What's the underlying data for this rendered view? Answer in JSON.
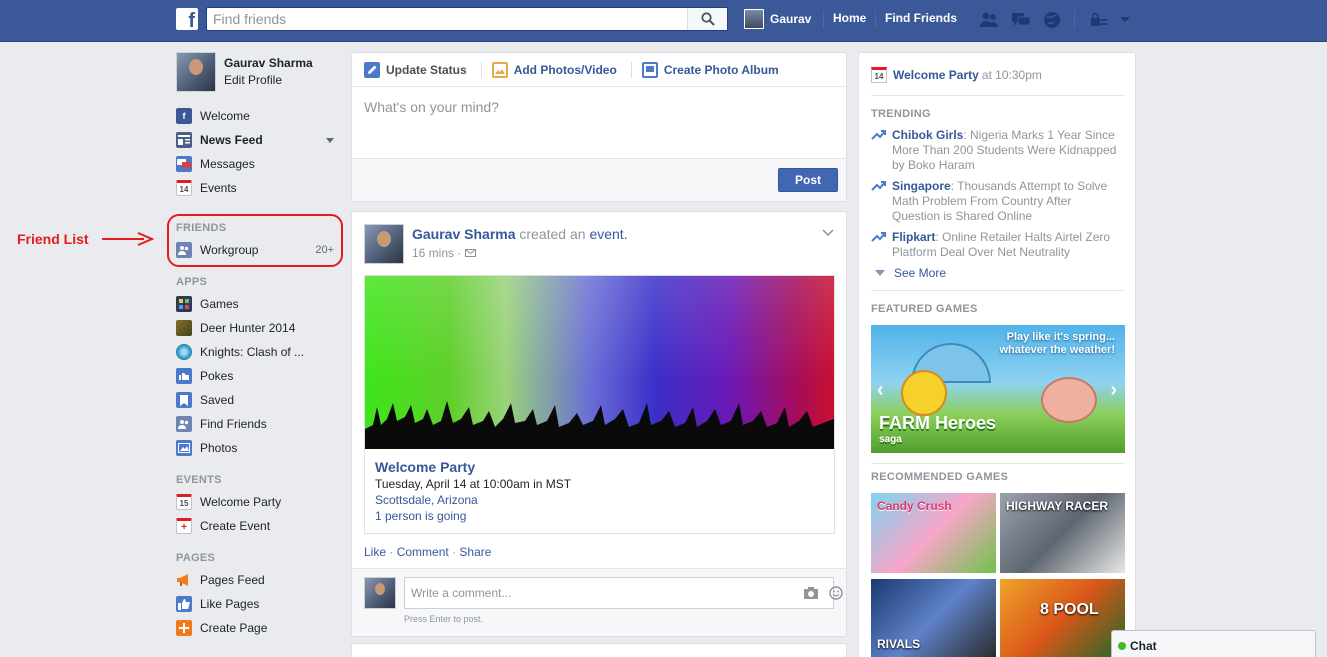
{
  "topbar": {
    "logo": "f",
    "search_placeholder": "Find friends",
    "user_name": "Gaurav",
    "home_label": "Home",
    "find_friends_label": "Find Friends"
  },
  "profile": {
    "name": "Gaurav Sharma",
    "edit_label": "Edit Profile"
  },
  "nav": {
    "main": [
      {
        "label": "Welcome",
        "icon": "facebook-icon"
      },
      {
        "label": "News Feed",
        "icon": "news-feed-icon"
      },
      {
        "label": "Messages",
        "icon": "messages-icon"
      },
      {
        "label": "Events",
        "icon": "calendar-icon",
        "badge": "14"
      }
    ],
    "friends_header": "FRIENDS",
    "friends": [
      {
        "label": "Workgroup",
        "count": "20+"
      }
    ],
    "apps_header": "APPS",
    "apps": [
      {
        "label": "Games"
      },
      {
        "label": "Deer Hunter 2014"
      },
      {
        "label": "Knights: Clash of ..."
      },
      {
        "label": "Pokes"
      },
      {
        "label": "Saved"
      },
      {
        "label": "Find Friends"
      },
      {
        "label": "Photos"
      }
    ],
    "events_header": "EVENTS",
    "events": [
      {
        "label": "Welcome Party",
        "badge": "15"
      },
      {
        "label": "Create Event",
        "badge": "+"
      }
    ],
    "pages_header": "PAGES",
    "pages": [
      {
        "label": "Pages Feed"
      },
      {
        "label": "Like Pages"
      },
      {
        "label": "Create Page"
      }
    ]
  },
  "annotation": {
    "label": "Friend List",
    "color": "#e31b23"
  },
  "composer": {
    "tabs": [
      "Update Status",
      "Add Photos/Video",
      "Create Photo Album"
    ],
    "placeholder": "What's on your mind?",
    "post_label": "Post"
  },
  "story": {
    "author": "Gaurav Sharma",
    "action": "created an",
    "object": "event.",
    "time": "16 mins ·",
    "event": {
      "name": "Welcome Party",
      "date": "Tuesday, April 14 at 10:00am in MST",
      "location": "Scottsdale, Arizona",
      "going": "1 person is going"
    },
    "actions": [
      "Like",
      "Comment",
      "Share"
    ],
    "comment_placeholder": "Write a comment...",
    "comment_hint": "Press Enter to post."
  },
  "rightcol": {
    "event_name": "Welcome Party",
    "event_time": "at 10:30pm",
    "event_badge": "14",
    "trending_header": "TRENDING",
    "trending": [
      {
        "topic": "Chibok Girls",
        "text": ": Nigeria Marks 1 Year Since More Than 200 Students Were Kidnapped by Boko Haram"
      },
      {
        "topic": "Singapore",
        "text": ": Thousands Attempt to Solve Math Problem From Country After Question is Shared Online"
      },
      {
        "topic": "Flipkart",
        "text": ": Online Retailer Halts Airtel Zero Platform Deal Over Net Neutrality"
      }
    ],
    "see_more": "See More",
    "featured_header": "FEATURED GAMES",
    "featured_banner_text": "Play like it's spring... whatever the weather!",
    "featured_logo": "FARM Heroes",
    "featured_logo_sub": "saga",
    "recommended_header": "RECOMMENDED GAMES",
    "recommended": [
      "Candy Crush",
      "HIGHWAY RACER",
      "RIVALS",
      "8 POOL"
    ]
  },
  "chat": {
    "label": "Chat"
  }
}
